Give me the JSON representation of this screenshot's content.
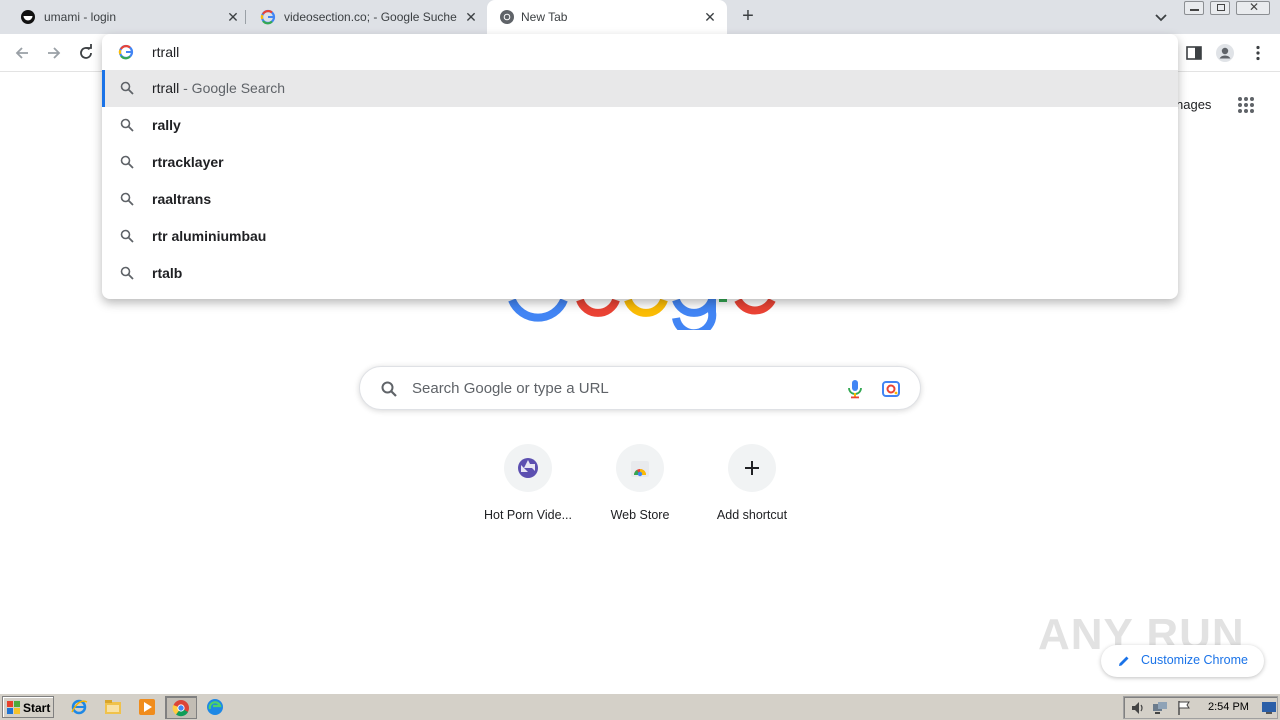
{
  "tabs": [
    {
      "title": "umami - login",
      "favicon": "umami-icon",
      "active": false
    },
    {
      "title": "videosection.co; - Google Suche",
      "favicon": "google-g-icon",
      "active": false
    },
    {
      "title": "New Tab",
      "favicon": "chrome-icon",
      "active": true
    }
  ],
  "omnibox": {
    "text": "rtrall",
    "suggestions": [
      {
        "query": "rtrall",
        "suffix": " - Google Search",
        "selected": true
      },
      {
        "query": "rally",
        "suffix": "",
        "selected": false
      },
      {
        "query": "rtracklayer",
        "suffix": "",
        "selected": false
      },
      {
        "query": "raaltrans",
        "suffix": "",
        "selected": false
      },
      {
        "query": "rtr aluminiumbau",
        "suffix": "",
        "selected": false
      },
      {
        "query": "rtalb",
        "suffix": "",
        "selected": false
      }
    ]
  },
  "page": {
    "images_link": "nages",
    "search_placeholder": "Search Google or type a URL",
    "shortcuts": [
      {
        "label": "Hot Porn Vide...",
        "icon": "aperture-icon"
      },
      {
        "label": "Web Store",
        "icon": "web-store-icon"
      },
      {
        "label": "Add shortcut",
        "icon": "plus-icon"
      }
    ],
    "customize_label": "Customize Chrome",
    "watermark": "ANY RUN"
  },
  "taskbar": {
    "start_label": "Start",
    "clock": "2:54 PM"
  },
  "colors": {
    "tabstrip": "#dee1e6",
    "accent": "#1a73e8",
    "selected_row": "#e8e8e9",
    "taskbar": "#d4d0c8"
  }
}
